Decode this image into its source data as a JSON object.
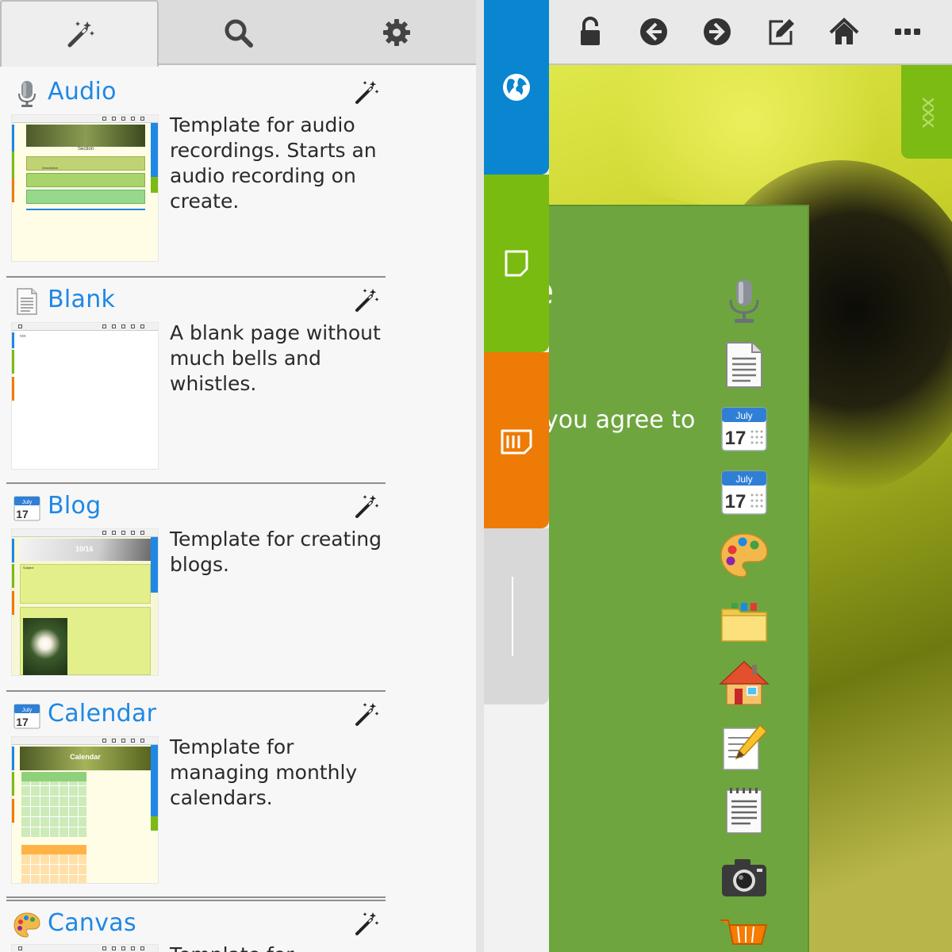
{
  "panel_tabs": [
    {
      "name": "magic-wand-icon",
      "active": true
    },
    {
      "name": "search-icon",
      "active": false
    },
    {
      "name": "gear-icon",
      "active": false
    }
  ],
  "templates": [
    {
      "title": "Audio",
      "icon": "microphone-icon",
      "description": "Template for audio recordings. Starts an audio recording on create.",
      "thumb": "audio"
    },
    {
      "title": "Blank",
      "icon": "document-icon",
      "description": "A blank page without much bells and whistles.",
      "thumb": "blank"
    },
    {
      "title": "Blog",
      "icon": "calendar-icon",
      "description": "Template for creating blogs.",
      "thumb": "blog"
    },
    {
      "title": "Calendar",
      "icon": "calendar-icon",
      "description": "Template for managing monthly calendars.",
      "thumb": "calendar"
    },
    {
      "title": "Canvas",
      "icon": "palette-icon",
      "description": "Template for",
      "thumb": "canvas"
    }
  ],
  "thumb_text": {
    "audio_section": "Section",
    "audio_row": "Description",
    "blank_text": "xxx",
    "blog_date": "10/16",
    "blog_subject": "Subject",
    "calendar_title": "Calendar"
  },
  "calendar_icon": {
    "month": "July",
    "day": "17"
  },
  "vertical_tabs": [
    {
      "name": "globe-icon",
      "color": "#0a85d0"
    },
    {
      "name": "note-icon",
      "color": "#79bb10"
    },
    {
      "name": "list-icon",
      "color": "#ee7b06"
    },
    {
      "name": "divider",
      "color": "#d8d8d8"
    }
  ],
  "toolbar": [
    "unlock-icon",
    "arrow-left-icon",
    "arrow-right-icon",
    "edit-icon",
    "home-icon",
    "more-icon"
  ],
  "card": {
    "text": "you agree to",
    "partial_letter": "e"
  },
  "side_tab": {
    "label": "xxx",
    "color": "#7cbb13"
  },
  "dock_icons": [
    "microphone-icon",
    "document-icon",
    "calendar-icon",
    "calendar-icon",
    "palette-icon",
    "folder-icon",
    "house-icon",
    "notepad-pencil-icon",
    "notepad-icon",
    "camera-icon",
    "shopping-cart-icon"
  ],
  "colors": {
    "accent": "#1e88e5",
    "green": "#7cbb13",
    "orange": "#ee7b06",
    "blue": "#0a85d0",
    "card": "#6ea53f"
  }
}
